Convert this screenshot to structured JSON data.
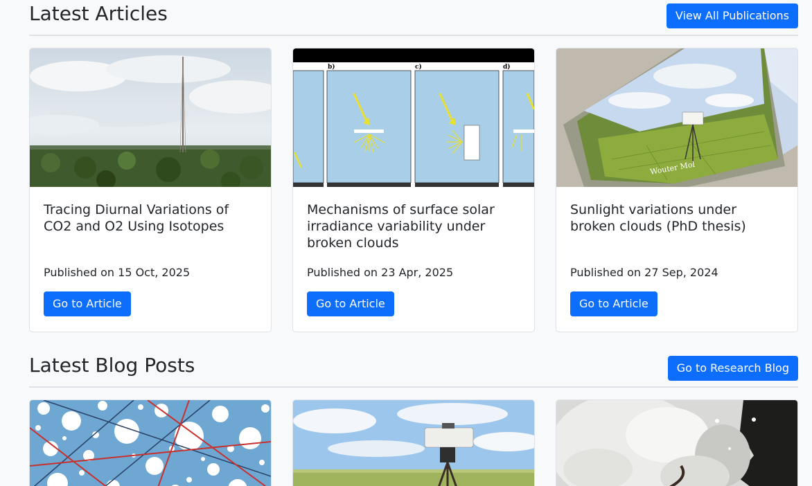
{
  "articles_section": {
    "title": "Latest Articles",
    "button_label": "View All Publications",
    "cards": [
      {
        "title": "Tracing Diurnal Variations of CO2 and O2 Using Isotopes",
        "date": "Published on 15 Oct, 2025",
        "button_label": "Go to Article",
        "image": "rainforest-tower-photo"
      },
      {
        "title": "Mechanisms of surface solar irradiance variability under broken clouds",
        "date": "Published on 23 Apr, 2025",
        "button_label": "Go to Article",
        "image": "irradiance-diagram",
        "diagram_panel_labels": [
          "b)",
          "c)",
          "d)"
        ]
      },
      {
        "title": "Sunlight variations under broken clouds (PhD thesis)",
        "date": "Published on 27 Sep, 2024",
        "button_label": "Go to Article",
        "image": "thesis-books-photo",
        "cover_text": "Wouter Mol"
      }
    ]
  },
  "blog_section": {
    "title": "Latest Blog Posts",
    "button_label": "Go to Research Blog",
    "cards": [
      {
        "image": "circles-lines-pattern"
      },
      {
        "image": "field-instrument-photo"
      },
      {
        "image": "satellite-cloud-photo"
      }
    ]
  },
  "colors": {
    "primary": "#0d6efd",
    "background": "#f8f9fa",
    "border": "#dee2e6",
    "text": "#212529"
  }
}
